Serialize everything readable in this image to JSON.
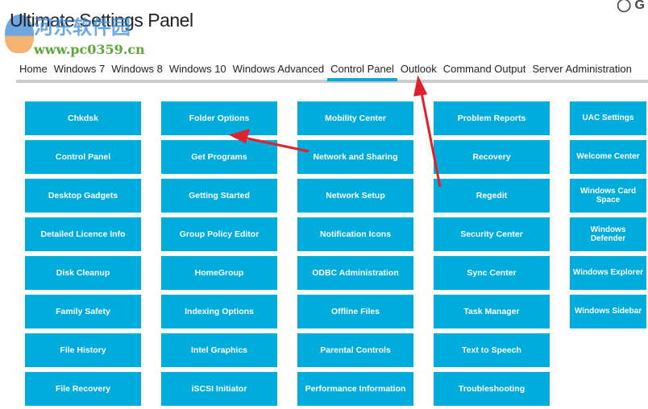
{
  "app": {
    "title": "Ultimate Settings Panel",
    "top_icons": [
      "github-icon",
      "G"
    ]
  },
  "watermark": {
    "name": "河东软件园",
    "url": "www.pc0359.cn"
  },
  "tabs": [
    "Home",
    "Windows 7",
    "Windows 8",
    "Windows 10",
    "Windows Advanced",
    "Control Panel",
    "Outlook",
    "Command Output",
    "Server Administration"
  ],
  "active_tab": "Control Panel",
  "columns": [
    [
      "Chkdsk",
      "Control Panel",
      "Desktop Gadgets",
      "Detailed Licence Info",
      "Disk Cleanup",
      "Family Safety",
      "File History",
      "File Recovery"
    ],
    [
      "Folder Options",
      "Get Programs",
      "Getting Started",
      "Group Policy Editor",
      "HomeGroup",
      "Indexing Options",
      "Intel Graphics",
      "iSCSI Initiator"
    ],
    [
      "Mobility Center",
      "Network and Sharing",
      "Network Setup",
      "Notification Icons",
      "ODBC Administration",
      "Offline Files",
      "Parental Controls",
      "Performance Information"
    ],
    [
      "Problem Reports",
      "Recovery",
      "Regedit",
      "Security Center",
      "Sync Center",
      "Task Manager",
      "Text to Speech",
      "Troubleshooting"
    ],
    [
      "UAC Settings",
      "Welcome Center",
      "Windows Card Space",
      "Windows Defender",
      "Windows Explorer",
      "Windows Sidebar"
    ]
  ],
  "colors": {
    "accent": "#00acdc",
    "arrow": "#e0202a"
  }
}
